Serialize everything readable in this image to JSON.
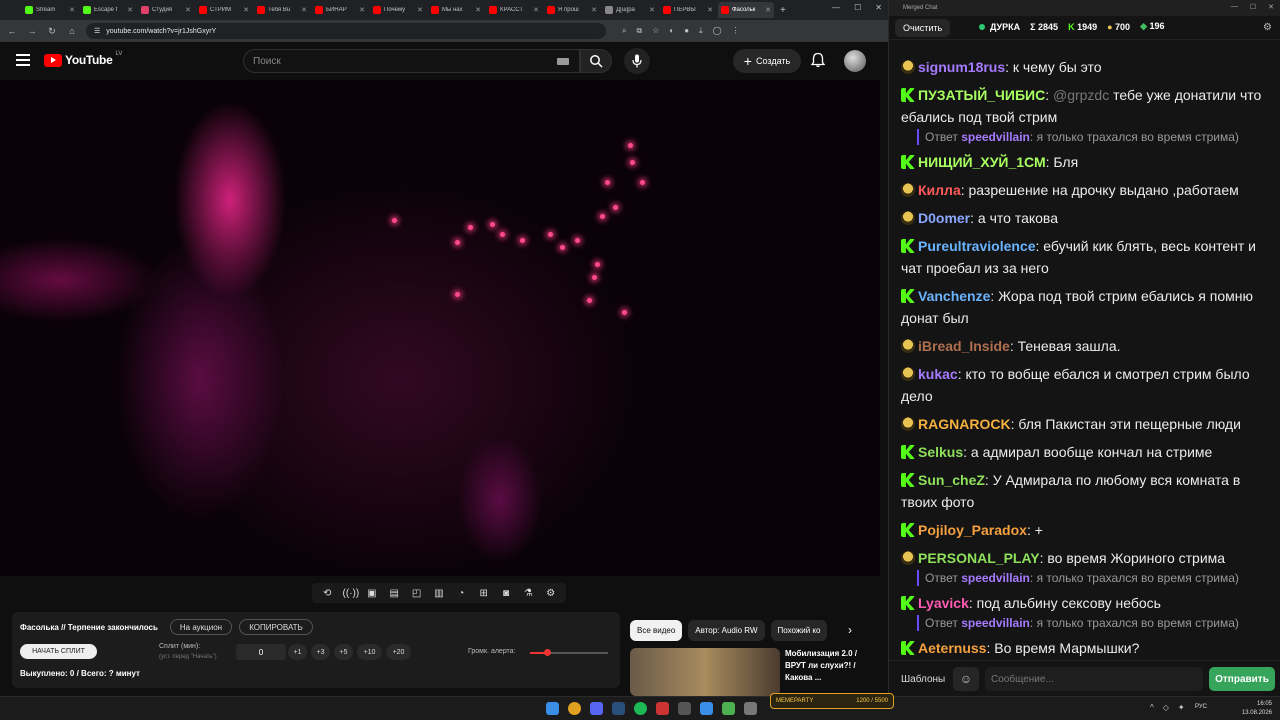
{
  "browser": {
    "tabs": [
      {
        "label": "Stream",
        "color": "#53fc18"
      },
      {
        "label": "Escape f",
        "color": "#53fc18"
      },
      {
        "label": "Студия",
        "color": "#e0406a"
      },
      {
        "label": "СТРИМ",
        "color": "#ff0000"
      },
      {
        "label": "Тебя Bu",
        "color": "#ff0000"
      },
      {
        "label": "БИНАР",
        "color": "#ff0000"
      },
      {
        "label": "Почему",
        "color": "#ff0000"
      },
      {
        "label": "Мы нах",
        "color": "#ff0000"
      },
      {
        "label": "КРАССТ",
        "color": "#ff0000"
      },
      {
        "label": "Я прош",
        "color": "#ff0000"
      },
      {
        "label": "Д[ш]ра",
        "color": "#888888"
      },
      {
        "label": "ПЕРВЫ",
        "color": "#ff0000"
      },
      {
        "label": "Фасольк",
        "color": "#ff0000",
        "active": true
      }
    ],
    "url": "youtube.com/watch?v=jr1JshGxyrY"
  },
  "youtube": {
    "logo_text": "YouTube",
    "country": "LV",
    "search_placeholder": "Поиск",
    "create_label": "Создать"
  },
  "split_panel": {
    "title": "Фасолька // Терпение закончилось",
    "auction_btn": "На аукцион",
    "copy_btn": "КОПИРОВАТЬ",
    "start_btn": "НАЧАТЬ СПЛИТ",
    "split_label": "Сплит (мин):",
    "split_hint": "(уст. перед \"Начать\")",
    "split_value": "0",
    "increments": [
      "+1",
      "+3",
      "+5",
      "+10",
      "+20"
    ],
    "status": "Выкуплено: 0 / Всего: ? минут",
    "volume_label": "Громк. алерта:",
    "volume_level": 0.22
  },
  "recommendations": {
    "chips": [
      "Все видео",
      "Автор: Audio RW",
      "Похожий ко"
    ],
    "video_title": "Мобилизация 2.0 / ВРУТ ли слухи?! / Какова ..."
  },
  "taskbar": {
    "lang": "РУС",
    "time": "16:05",
    "date": "13.08.2026",
    "meme_label": "MEMEPARTY",
    "meme_value": "1200 / 5500"
  },
  "chat": {
    "window_title": "Merged Chat",
    "clear_btn": "Очистить",
    "stream_name": "ДУРКА",
    "stat_total": "Σ 2845",
    "stat_kick": "1949",
    "stat_twitch": "700",
    "stat_other": "196",
    "input_placeholder": "Сообщение...",
    "templates_btn": "Шаблоны",
    "send_btn": "Отправить",
    "messages": [
      {
        "badge": "t",
        "nick": "signum18rus",
        "color": "#a67bff",
        "text": "к чему бы это"
      },
      {
        "badge": "k",
        "nick": "ПУЗАТЫЙ_ЧИБИС",
        "color": "#a8ff60",
        "mention": "@grpzdc",
        "text": "тебе уже донатили что ебались под твой стрим",
        "reply": {
          "nick": "speedvillain",
          "text": "я только трахался во время стрима)"
        }
      },
      {
        "badge": "k",
        "nick": "НИЩИЙ_ХУЙ_1СМ",
        "color": "#a8ff60",
        "text": "Бля"
      },
      {
        "badge": "t",
        "nick": "Килла",
        "color": "#ff5a5a",
        "text": "разрешение на дрочку выдано ,работаем"
      },
      {
        "badge": "t",
        "nick": "D0omer",
        "color": "#8aa8ff",
        "text": "а что такова"
      },
      {
        "badge": "k",
        "nick": "Pureultraviolence",
        "color": "#6ab4ff",
        "text": "ебучий кик блять, весь контент и чат проебал из за него"
      },
      {
        "badge": "k",
        "nick": "Vanchenze",
        "color": "#6ab4ff",
        "text": "Жора под твой стрим ебались я помню донат был"
      },
      {
        "badge": "t",
        "nick": "iBread_Inside",
        "color": "#b07050",
        "text": "Теневая зашла."
      },
      {
        "badge": "t",
        "nick": "kukac",
        "color": "#a67bff",
        "text": "кто то вобще ебался и смотрел стрим было дело"
      },
      {
        "badge": "t",
        "nick": "RAGNAROCK",
        "color": "#f5b040",
        "text": "бля Пакистан эти пещерные люди"
      },
      {
        "badge": "k",
        "nick": "Selkus",
        "color": "#8ee05a",
        "text": "а адмирал вообще кончал    на стриме"
      },
      {
        "badge": "k",
        "nick": "Sun_cheZ",
        "color": "#8ee05a",
        "text": "У Адмирала по любому вся комната в твоих фото"
      },
      {
        "badge": "k",
        "nick": "Pojiloy_Paradox",
        "color": "#f5a040",
        "text": "+"
      },
      {
        "badge": "t",
        "nick": "PERSONAL_PLAY",
        "color": "#8ee05a",
        "text": "во время Жориного стрима",
        "reply": {
          "nick": "speedvillain",
          "text": "я только трахался во время стрима)"
        }
      },
      {
        "badge": "k",
        "nick": "Lyavick",
        "color": "#ff5ab4",
        "text": "под альбину сексову небось",
        "reply": {
          "nick": "speedvillain",
          "text": "я только трахался во время стрима)"
        }
      },
      {
        "badge": "k",
        "nick": "Aeternuss",
        "color": "#f5a040",
        "text": "Во время Мармышки?"
      }
    ]
  }
}
